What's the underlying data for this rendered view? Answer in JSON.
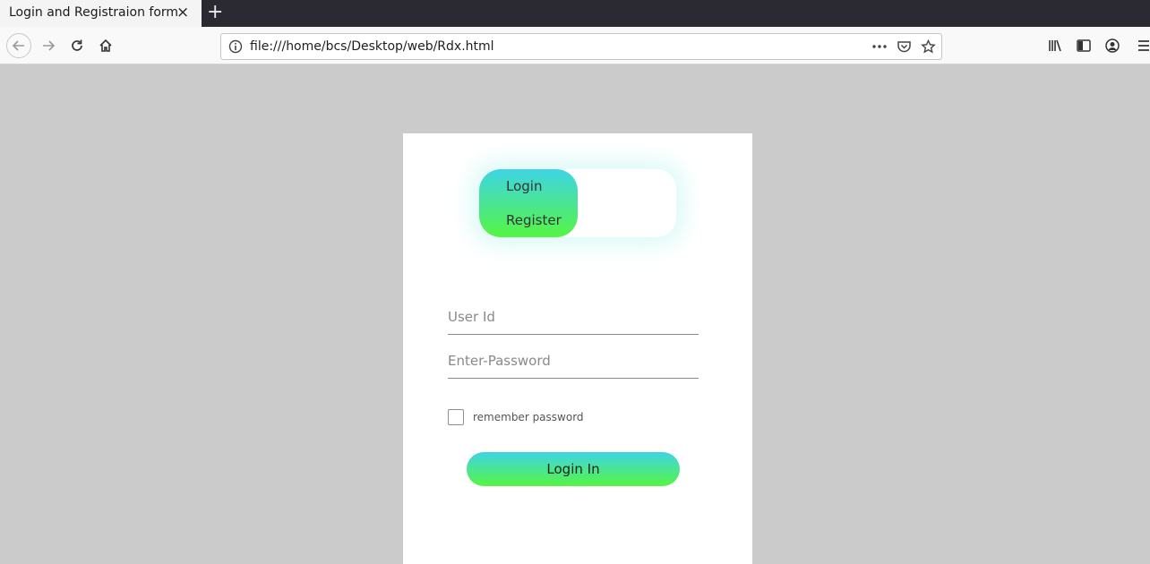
{
  "browser": {
    "tab_title": "Login and Registraion form",
    "tab_close": "×",
    "new_tab": "+",
    "url": "file:///home/bcs/Desktop/web/Rdx.html",
    "icons": [
      "back-icon",
      "forward-icon",
      "reload-icon",
      "home-icon",
      "info-icon",
      "more-icon",
      "pocket-icon",
      "bookmark-star-icon",
      "library-icon",
      "sidebar-icon",
      "account-icon",
      "menu-icon"
    ]
  },
  "form": {
    "toggle_login": "Login",
    "toggle_register": "Register",
    "user_placeholder": "User Id",
    "password_placeholder": "Enter-Password",
    "remember_label": "remember password",
    "submit_label": "Login In",
    "gradient_top": "#3fd4e6",
    "gradient_bottom": "#55f542"
  }
}
